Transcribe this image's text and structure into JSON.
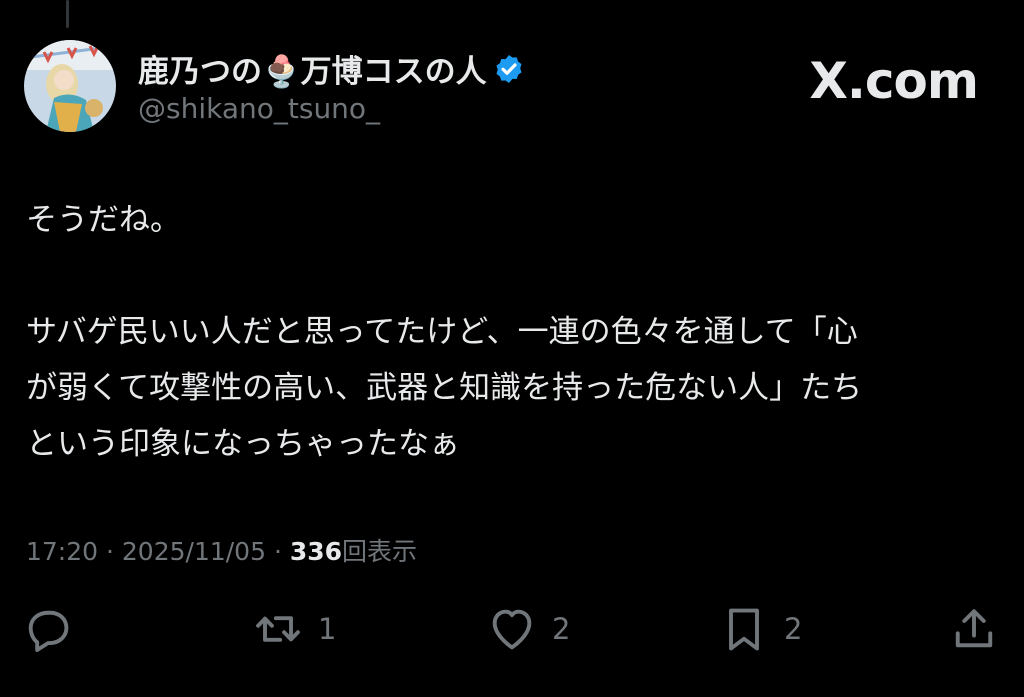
{
  "post": {
    "author": {
      "display_name": "鹿乃つの🍨万博コスの人",
      "handle": "@shikano_tsuno_",
      "verified": true,
      "avatar_icon": "avatar-photo"
    },
    "brand": "X.com",
    "text_lines": [
      "そうだね。",
      "",
      "サバゲ民いい人だと思ってたけど、一連の色々を通して「心",
      "が弱くて攻撃性の高い、武器と知識を持った危ない人」たち",
      "という印象になっちゃったなぁ"
    ],
    "meta": {
      "time": "17:20",
      "sep1": "·",
      "date": "2025/11/05",
      "sep2": "·",
      "views_count": "336",
      "views_label": "回表示"
    },
    "actions": {
      "reply": {
        "icon": "reply-icon",
        "count": ""
      },
      "repost": {
        "icon": "repost-icon",
        "count": "1"
      },
      "like": {
        "icon": "heart-icon",
        "count": "2"
      },
      "bookmark": {
        "icon": "bookmark-icon",
        "count": "2"
      },
      "share": {
        "icon": "share-icon",
        "count": ""
      }
    }
  },
  "colors": {
    "background": "#000000",
    "text": "#e7e9ea",
    "secondary": "#71767b",
    "verified": "#1d9bf0"
  }
}
